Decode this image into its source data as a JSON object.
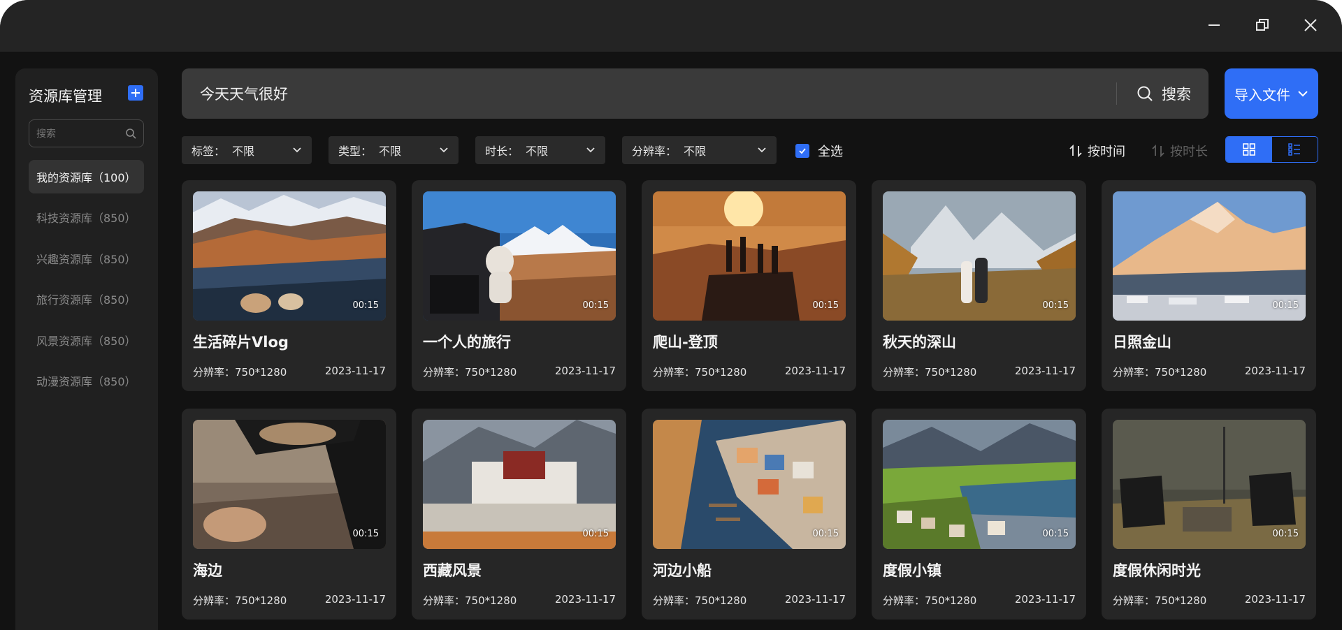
{
  "colors": {
    "accent": "#2f6ef6",
    "background": "#121212",
    "panel": "#202020",
    "card": "#262626",
    "titlebar": "#242424"
  },
  "window_controls": [
    {
      "name": "minimize",
      "icon": "minimize-icon"
    },
    {
      "name": "restore",
      "icon": "restore-icon"
    },
    {
      "name": "close",
      "icon": "close-icon"
    }
  ],
  "sidebar": {
    "title": "资源库管理",
    "add_icon": "plus-icon",
    "search_placeholder": "搜索",
    "items": [
      {
        "label": "我的资源库（100）",
        "active": true
      },
      {
        "label": "科技资源库（850）",
        "active": false
      },
      {
        "label": "兴趣资源库（850）",
        "active": false
      },
      {
        "label": "旅行资源库（850）",
        "active": false
      },
      {
        "label": "风景资源库（850）",
        "active": false
      },
      {
        "label": "动漫资源库（850）",
        "active": false
      }
    ]
  },
  "search": {
    "value": "今天天气很好",
    "button_label": "搜索",
    "icon": "search-icon"
  },
  "import_button": {
    "label": "导入文件",
    "icon": "chevron-down-icon"
  },
  "filters": [
    {
      "label": "标签：",
      "value": "不限"
    },
    {
      "label": "类型：",
      "value": "不限"
    },
    {
      "label": "时长：",
      "value": "不限"
    },
    {
      "label": "分辨率：",
      "value": "不限"
    }
  ],
  "select_all": {
    "label": "全选",
    "checked": true
  },
  "sort": [
    {
      "label": "按时间",
      "active": true,
      "icon": "sort-icon"
    },
    {
      "label": "按时长",
      "active": false,
      "icon": "sort-icon"
    }
  ],
  "view_modes": [
    {
      "name": "grid",
      "icon": "grid-icon",
      "active": true
    },
    {
      "name": "list",
      "icon": "list-icon",
      "active": false
    }
  ],
  "cards": [
    {
      "title": "生活碎片Vlog",
      "duration": "00:15",
      "resolution": "分辨率：750*1280",
      "date": "2023-11-17",
      "image": "mountain-ridge-travel-photo"
    },
    {
      "title": "一个人的旅行",
      "duration": "00:15",
      "resolution": "分辨率：750*1280",
      "date": "2023-11-17",
      "image": "woman-by-car-snow-mountain-photo"
    },
    {
      "title": "爬山-登顶",
      "duration": "00:15",
      "resolution": "分辨率：750*1280",
      "date": "2023-11-17",
      "image": "hikers-summit-sunset-photo"
    },
    {
      "title": "秋天的深山",
      "duration": "00:15",
      "resolution": "分辨率：750*1280",
      "date": "2023-11-17",
      "image": "couple-autumn-mountain-photo"
    },
    {
      "title": "日照金山",
      "duration": "00:15",
      "resolution": "分辨率：750*1280",
      "date": "2023-11-17",
      "image": "golden-snow-mountain-photo"
    },
    {
      "title": "海边",
      "duration": "00:15",
      "resolution": "分辨率：750*1280",
      "date": "2023-11-17",
      "image": "seaside-car-mirror-photo"
    },
    {
      "title": "西藏风景",
      "duration": "00:15",
      "resolution": "分辨率：750*1280",
      "date": "2023-11-17",
      "image": "potala-palace-photo"
    },
    {
      "title": "河边小船",
      "duration": "00:15",
      "resolution": "分辨率：750*1280",
      "date": "2023-11-17",
      "image": "riverside-harbor-town-photo"
    },
    {
      "title": "度假小镇",
      "duration": "00:15",
      "resolution": "分辨率：750*1280",
      "date": "2023-11-17",
      "image": "alpine-village-lake-photo"
    },
    {
      "title": "度假休闲时光",
      "duration": "00:15",
      "resolution": "分辨率：750*1280",
      "date": "2023-11-17",
      "image": "camping-chairs-meadow-photo"
    }
  ]
}
